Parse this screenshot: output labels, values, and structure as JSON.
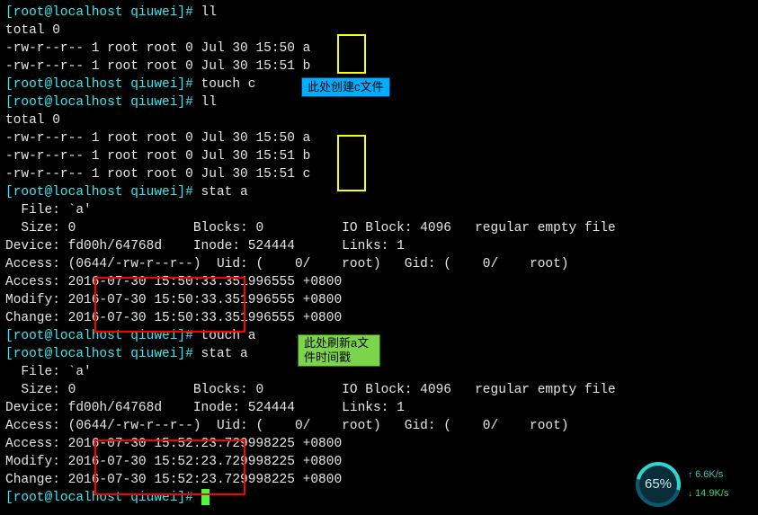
{
  "prompt_user": "root",
  "prompt_host": "localhost",
  "prompt_dir": "qiuwei",
  "prompt_symbol": "#",
  "lines": {
    "ll1": "ll",
    "total0_1": "total 0",
    "ls_a1": "-rw-r--r-- 1 root root 0 Jul 30 15:50 a",
    "ls_b1": "-rw-r--r-- 1 root root 0 Jul 30 15:51 b",
    "touch_c": "touch c",
    "ll2": "ll",
    "total0_2": "total 0",
    "ls_a2": "-rw-r--r-- 1 root root 0 Jul 30 15:50 a",
    "ls_b2": "-rw-r--r-- 1 root root 0 Jul 30 15:51 b",
    "ls_c2": "-rw-r--r-- 1 root root 0 Jul 30 15:51 c",
    "stat_a1": "stat a",
    "file_a1": "  File: `a'",
    "size_a1": "  Size: 0               Blocks: 0          IO Block: 4096   regular empty file",
    "dev_a1": "Device: fd00h/64768d    Inode: 524444      Links: 1",
    "acc_a1": "Access: (0644/-rw-r--r--)  Uid: (    0/    root)   Gid: (    0/    root)",
    "at_a1": "Access: 2016-07-30 15:50:33.351996555 +0800",
    "mt_a1": "Modify: 2016-07-30 15:50:33.351996555 +0800",
    "ct_a1": "Change: 2016-07-30 15:50:33.351996555 +0800",
    "touch_a": "touch a",
    "stat_a2": "stat a",
    "file_a2": "  File: `a'",
    "size_a2": "  Size: 0               Blocks: 0          IO Block: 4096   regular empty file",
    "dev_a2": "Device: fd00h/64768d    Inode: 524444      Links: 1",
    "acc_a2": "Access: (0644/-rw-r--r--)  Uid: (    0/    root)   Gid: (    0/    root)",
    "at_a2": "Access: 2016-07-30 15:52:23.729998225 +0800",
    "mt_a2": "Modify: 2016-07-30 15:52:23.729998225 +0800",
    "ct_a2": "Change: 2016-07-30 15:52:23.729998225 +0800"
  },
  "labels": {
    "blue": "此处创建c文件",
    "green": "此处刷新a文件时间戳"
  },
  "widget": {
    "percent": "65%",
    "up": "6.6K/s",
    "down": "14.9K/s"
  }
}
